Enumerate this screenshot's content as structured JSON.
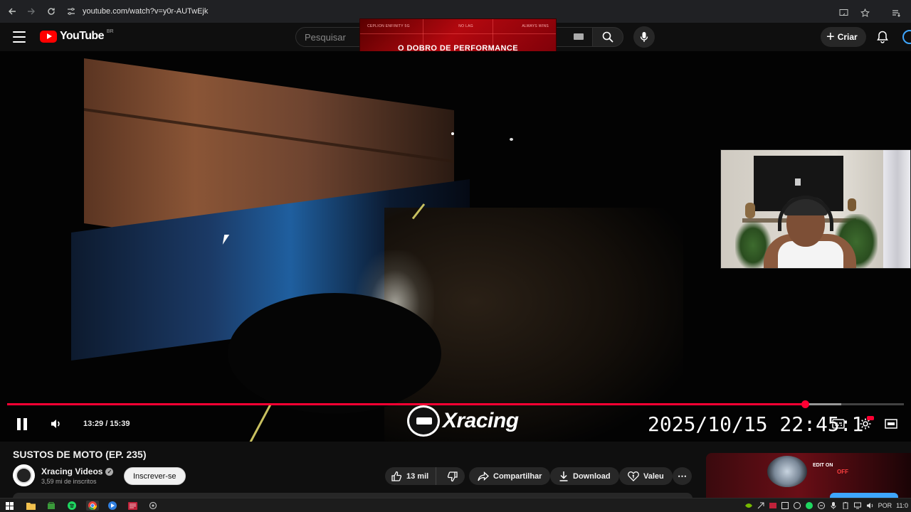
{
  "browser": {
    "url": "youtube.com/watch?v=y0r-AUTwEjk",
    "icons": [
      "back-icon",
      "forward-icon",
      "reload-icon",
      "site-settings-icon",
      "cast-icon",
      "bookmark-star-icon",
      "reading-list-icon"
    ]
  },
  "header": {
    "logo_text": "YouTube",
    "region": "BR",
    "search_placeholder": "Pesquisar",
    "create_label": "Criar"
  },
  "ad": {
    "tags": [
      "CEPLION ENFINITY 5G",
      "NO LAG",
      "ALWAYS WINS"
    ],
    "title": "O DOBRO DE PERFORMANCE",
    "colors": {
      "primary": "#b3080f",
      "dark": "#5a0000"
    }
  },
  "player": {
    "time_display": "13:29 / 15:39",
    "progress": {
      "played_fraction": 0.89,
      "buffered_fraction": 0.93
    },
    "overlay_logo": "Xracing",
    "datestamp": "2025/10/15  22:45:1",
    "accent_color": "#ff0033"
  },
  "video_info": {
    "title": "SUSTOS DE MOTO (EP. 235)",
    "channel_name": "Xracing Videos",
    "subscribers": "3,59 mi de inscritos",
    "subscribe_label": "Inscrever-se",
    "likes": "13 mil",
    "share_label": "Compartilhar",
    "download_label": "Download",
    "thanks_label": "Valeu"
  },
  "sidebar_thumb": {
    "tag1": "EDIT ON",
    "tag2": "OFF"
  },
  "taskbar": {
    "language": "POR",
    "clock": "11:0"
  }
}
